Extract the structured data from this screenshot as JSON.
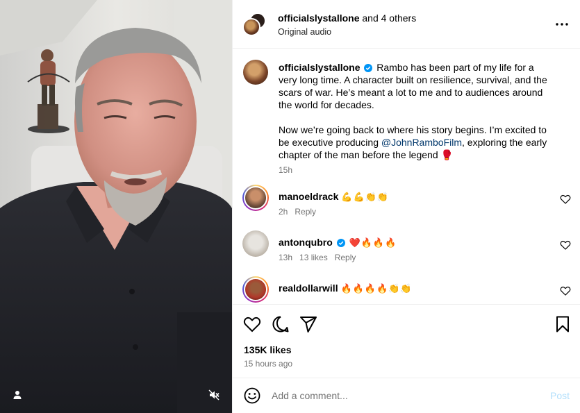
{
  "header": {
    "username": "officialslystallone",
    "collab_suffix": " and 4 others",
    "audio": "Original audio",
    "more_icon": "more-horizontal-icon"
  },
  "caption": {
    "username": "officialslystallone",
    "verified": true,
    "paragraph1": "Rambo has been part of my life for a very long time. A character built on resilience, survival, and the scars of war. He’s meant a lot to me and to audiences around the world for decades.",
    "paragraph2_before": "Now we’re going back to where his story begins. I’m excited to be executive producing ",
    "mention": "@JohnRamboFilm",
    "paragraph2_after": ", exploring the early chapter of the man before the legend ",
    "end_emoji": "🥊",
    "time": "15h"
  },
  "comments": [
    {
      "username": "manoeldrack",
      "verified": false,
      "text": "💪💪👏👏",
      "time": "2h",
      "likes": "",
      "reply": "Reply"
    },
    {
      "username": "antonqubro",
      "verified": true,
      "text": "❤️🔥🔥🔥",
      "time": "13h",
      "likes": "13 likes",
      "reply": "Reply"
    },
    {
      "username": "realdollarwill",
      "verified": false,
      "text": "🔥🔥🔥🔥👏👏",
      "time": "",
      "likes": "",
      "reply": ""
    }
  ],
  "actions": {
    "likes": "135K likes",
    "ago": "15 hours ago"
  },
  "add_comment": {
    "placeholder": "Add a comment...",
    "post_label": "Post"
  },
  "colors": {
    "link": "#00376b",
    "muted": "#737373",
    "post_disabled": "#b2dffc",
    "verified": "#0095f6"
  }
}
